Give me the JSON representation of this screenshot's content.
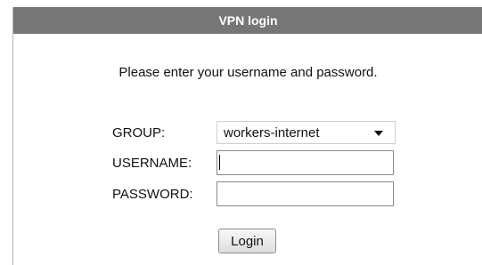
{
  "dialog": {
    "title": "VPN login",
    "instructions": "Please enter your username and password."
  },
  "form": {
    "group": {
      "label": "GROUP:",
      "selected": "workers-internet"
    },
    "username": {
      "label": "USERNAME:",
      "value": ""
    },
    "password": {
      "label": "PASSWORD:",
      "value": ""
    },
    "login_button": "Login"
  }
}
